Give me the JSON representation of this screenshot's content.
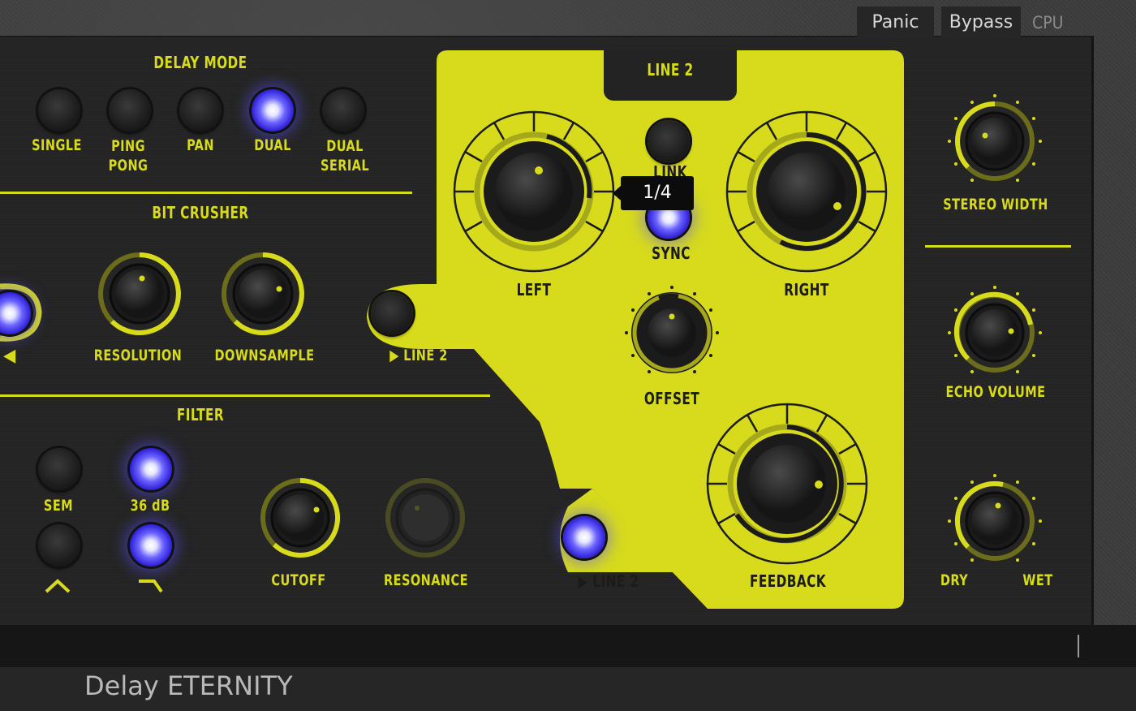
{
  "app_title": "Delay ETERNITY",
  "colors": {
    "accent": "#d7db1c",
    "panel": "#242424",
    "led_on": "#5a50ff"
  },
  "delay_mode": {
    "title": "DELAY MODE",
    "options": [
      "SINGLE",
      "PING\nPONG",
      "PAN",
      "DUAL",
      "DUAL\nSERIAL"
    ],
    "selected": "DUAL"
  },
  "bit_crusher": {
    "title": "BIT CRUSHER",
    "resolution_label": "RESOLUTION",
    "downsample_label": "DOWNSAMPLE",
    "left_arrow": "◀"
  },
  "filter": {
    "title": "FILTER",
    "sem_label": "SEM",
    "slope_label": "36 dB",
    "cutoff_label": "CUTOFF",
    "resonance_label": "RESONANCE",
    "lp_symbol": "^",
    "hp_symbol": "¬"
  },
  "line2": {
    "title": "LINE 2",
    "left_label": "LEFT",
    "right_label": "RIGHT",
    "link_label": "LINK",
    "sync_label": "SYNC",
    "offset_label": "OFFSET",
    "feedback_label": "FEEDBACK",
    "route_label_1": "▶ LINE 2",
    "route_label_2": "▶ LINE 2",
    "tooltip": "1/4"
  },
  "output": {
    "stereo_width_label": "STEREO WIDTH",
    "echo_volume_label": "ECHO VOLUME",
    "dry_label": "DRY",
    "wet_label": "WET"
  },
  "footer": {
    "panic_label": "Panic",
    "bypass_label": "Bypass",
    "cpu_label": "CPU"
  }
}
